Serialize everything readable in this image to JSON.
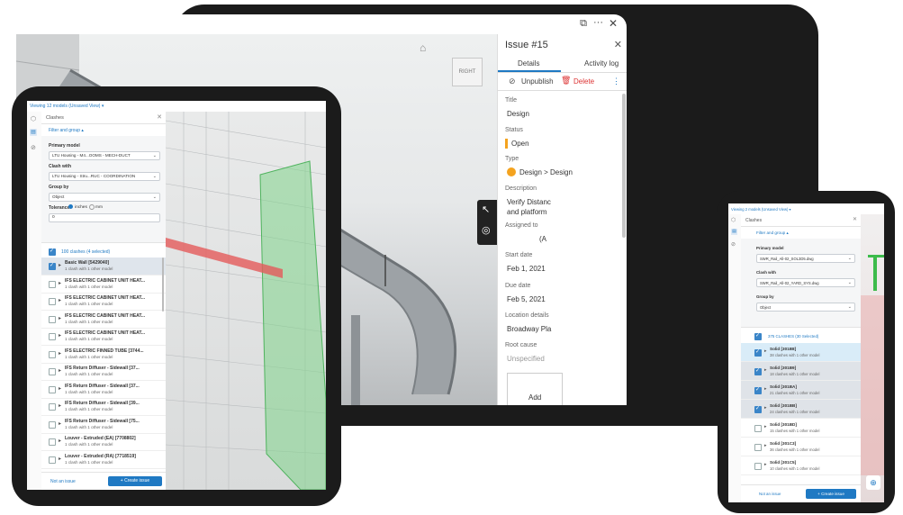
{
  "issue": {
    "title": "Issue #15",
    "tabs": [
      "Details",
      "Activity log"
    ],
    "unpublish": "Unpublish",
    "delete": "Delete",
    "title_label": "Title",
    "title_value": "Design",
    "status_label": "Status",
    "status_value": "Open",
    "type_label": "Type",
    "type_value": "Design > Design",
    "description_label": "Description",
    "description_value": "Verify Distanc and platform",
    "assigned_label": "Assigned to",
    "assigned_value": "(A",
    "start_label": "Start date",
    "start_value": "Feb 1, 2021",
    "due_label": "Due date",
    "due_value": "Feb 5, 2021",
    "location_label": "Location details",
    "location_value": "Broadway Pla",
    "root_label": "Root cause",
    "root_value": "Unspecified",
    "add_label": "Add"
  },
  "viewcube": "RIGHT",
  "left": {
    "viewing": "Viewing 12 models (Unsaved View) ▾",
    "panel_title": "Clashes",
    "filter": "Filter and group ▴",
    "primary_label": "Primary model",
    "primary_value": "LTU Housing - M4...OOMS - MECH-DUCT",
    "clash_label": "Clash with",
    "clash_value": "LTU Housing - Stru...RUC - COORDINATION",
    "group_label": "Group by",
    "group_value": "Object",
    "tolerance_label": "Tolerance",
    "tol_in": "inches",
    "tol_mm": "mm",
    "tol_value": "0",
    "count": "100 clashes (4 selected)",
    "items": [
      {
        "name": "Basic Wall [5429040]",
        "sub": "1 clash with 1 other model"
      },
      {
        "name": "IFS ELECTRIC CABINET UNIT HEAT...",
        "sub": "1 clash with 1 other model"
      },
      {
        "name": "IFS ELECTRIC CABINET UNIT HEAT...",
        "sub": "1 clash with 1 other model"
      },
      {
        "name": "IFS ELECTRIC CABINET UNIT HEAT...",
        "sub": "1 clash with 1 other model"
      },
      {
        "name": "IFS ELECTRIC CABINET UNIT HEAT...",
        "sub": "1 clash with 1 other model"
      },
      {
        "name": "IFS ELECTRIC FINNED TUBE [3744...",
        "sub": "1 clash with 1 other model"
      },
      {
        "name": "IFS Return Diffuser - Sidewall [37...",
        "sub": "1 clash with 1 other model"
      },
      {
        "name": "IFS Return Diffuser - Sidewall [37...",
        "sub": "1 clash with 1 other model"
      },
      {
        "name": "IFS Return Diffuser - Sidewall [39...",
        "sub": "1 clash with 1 other model"
      },
      {
        "name": "IFS Return Diffuser - Sidewall [75...",
        "sub": "1 clash with 1 other model"
      },
      {
        "name": "Louver - Extruded (EA) [7708802]",
        "sub": "1 clash with 1 other model"
      },
      {
        "name": "Louver - Extruded (RA) [7718519]",
        "sub": "1 clash with 1 other model"
      }
    ],
    "not_issue": "Not an issue",
    "create": "+ Create issue"
  },
  "right": {
    "viewing": "Viewing 2 models (Unsaved View) ▾",
    "panel_title": "Clashes",
    "filter": "Filter and group ▴",
    "primary_label": "Primary model",
    "primary_value": "SWR_Rail_All-02_SOL3D5.dwg",
    "clash_label": "Clash with",
    "clash_value": "SWR_Rail_All-02_YARD_SYS.dwg",
    "group_label": "Group by",
    "group_value": "Object",
    "count": "375 CLASHES (30 Selected)",
    "items": [
      {
        "name": "Solid [301B8]",
        "sub": "38 clashes with 1 other model"
      },
      {
        "name": "Solid [301B9]",
        "sub": "18 clashes with 1 other model"
      },
      {
        "name": "Solid [301BA]",
        "sub": "21 clashes with 1 other model"
      },
      {
        "name": "Solid [301BB]",
        "sub": "24 clashes with 1 other model"
      },
      {
        "name": "Solid [301BD]",
        "sub": "15 clashes with 1 other model"
      },
      {
        "name": "Solid [301C3]",
        "sub": "36 clashes with 1 other model"
      },
      {
        "name": "Solid [301C5]",
        "sub": "10 clashes with 1 other model"
      }
    ],
    "not_issue": "Not an issue",
    "create": "+ Create issue"
  }
}
